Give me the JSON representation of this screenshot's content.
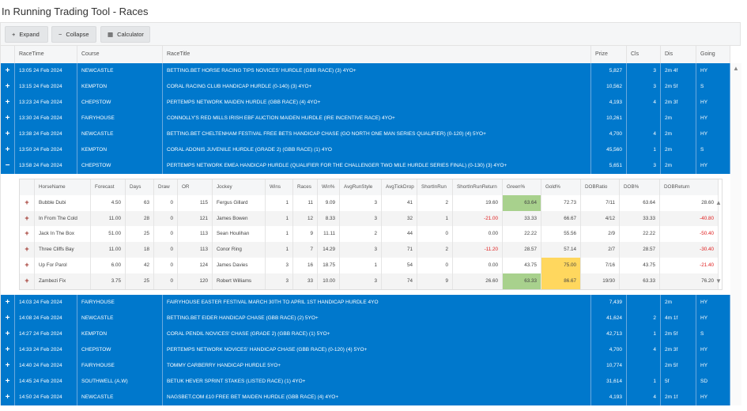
{
  "title": "In Running Trading Tool - Races",
  "toolbar": {
    "expand": "Expand",
    "collapse": "Collapse",
    "calculator": "Calculator"
  },
  "races_columns": [
    "RaceTime",
    "Course",
    "RaceTitle",
    "Prize",
    "Cls",
    "Dis",
    "Going"
  ],
  "races_top": [
    {
      "exp": "+",
      "time": "13:05 24 Feb 2024",
      "course": "NEWCASTLE",
      "title": "BETTING.BET HORSE RACING TIPS NOVICES' HURDLE (GBB RACE) (3) 4YO+",
      "prize": "5,827",
      "cls": "3",
      "dis": "2m 4f",
      "going": "HY"
    },
    {
      "exp": "+",
      "time": "13:15 24 Feb 2024",
      "course": "KEMPTON",
      "title": "CORAL RACING CLUB HANDICAP HURDLE (0-140) (3) 4YO+",
      "prize": "10,562",
      "cls": "3",
      "dis": "2m 5f",
      "going": "S"
    },
    {
      "exp": "+",
      "time": "13:23 24 Feb 2024",
      "course": "CHEPSTOW",
      "title": "PERTEMPS NETWORK MAIDEN HURDLE (GBB RACE) (4) 4YO+",
      "prize": "4,193",
      "cls": "4",
      "dis": "2m 3f",
      "going": "HY"
    },
    {
      "exp": "+",
      "time": "13:30 24 Feb 2024",
      "course": "FAIRYHOUSE",
      "title": "CONNOLLY'S RED MILLS IRISH EBF AUCTION MAIDEN HURDLE (IRE INCENTIVE RACE) 4YO+",
      "prize": "10,261",
      "cls": "",
      "dis": "2m",
      "going": "HY"
    },
    {
      "exp": "+",
      "time": "13:38 24 Feb 2024",
      "course": "NEWCASTLE",
      "title": "BETTING.BET CHELTENHAM FESTIVAL FREE BETS HANDICAP CHASE (GO NORTH ONE MAN SERIES QUALIFIER) (0-120) (4) 5YO+",
      "prize": "4,700",
      "cls": "4",
      "dis": "2m",
      "going": "HY"
    },
    {
      "exp": "+",
      "time": "13:50 24 Feb 2024",
      "course": "KEMPTON",
      "title": "CORAL ADONIS JUVENILE HURDLE (GRADE 2) (GBB RACE) (1) 4YO",
      "prize": "45,560",
      "cls": "1",
      "dis": "2m",
      "going": "S"
    },
    {
      "exp": "−",
      "time": "13:58 24 Feb 2024",
      "course": "CHEPSTOW",
      "title": "PERTEMPS NETWORK EMEA HANDICAP HURDLE (QUALIFIER FOR THE CHALLENGER TWO MILE HURDLE SERIES FINAL) (0-130) (3) 4YO+",
      "prize": "5,651",
      "cls": "3",
      "dis": "2m",
      "going": "HY"
    }
  ],
  "horse_columns": [
    "HorseName",
    "Forecast",
    "Days",
    "Draw",
    "OR",
    "Jockey",
    "Wins",
    "Races",
    "Win%",
    "AvgRunStyle",
    "AvgTickDrop",
    "ShortInRun",
    "ShortInRunReturn",
    "Green%",
    "Gold%",
    "DOBRatio",
    "DOB%",
    "DOBReturn"
  ],
  "horses": [
    {
      "name": "Bubble Dubi",
      "forecast": "4.50",
      "days": "63",
      "draw": "0",
      "or": "115",
      "jockey": "Fergus Gillard",
      "wins": "1",
      "races": "11",
      "winpct": "9.09",
      "runstyle": "3",
      "tickdrop": "41",
      "shortinrun": "2",
      "sirreturn": "19.60",
      "green": "63.64",
      "gold": "72.73",
      "dobratio": "7/11",
      "dobpct": "63.64",
      "dobreturn": "28.60"
    },
    {
      "name": "In From The Cold",
      "forecast": "11.00",
      "days": "28",
      "draw": "0",
      "or": "121",
      "jockey": "James Bowen",
      "wins": "1",
      "races": "12",
      "winpct": "8.33",
      "runstyle": "3",
      "tickdrop": "32",
      "shortinrun": "1",
      "sirreturn": "-21.00",
      "green": "33.33",
      "gold": "66.67",
      "dobratio": "4/12",
      "dobpct": "33.33",
      "dobreturn": "-40.80"
    },
    {
      "name": "Jack In The Box",
      "forecast": "51.00",
      "days": "25",
      "draw": "0",
      "or": "113",
      "jockey": "Sean Houlihan",
      "wins": "1",
      "races": "9",
      "winpct": "11.11",
      "runstyle": "2",
      "tickdrop": "44",
      "shortinrun": "0",
      "sirreturn": "0.00",
      "green": "22.22",
      "gold": "55.56",
      "dobratio": "2/9",
      "dobpct": "22.22",
      "dobreturn": "-50.40"
    },
    {
      "name": "Three Cliffs Bay",
      "forecast": "11.00",
      "days": "18",
      "draw": "0",
      "or": "113",
      "jockey": "Conor Ring",
      "wins": "1",
      "races": "7",
      "winpct": "14.29",
      "runstyle": "3",
      "tickdrop": "71",
      "shortinrun": "2",
      "sirreturn": "-11.20",
      "green": "28.57",
      "gold": "57.14",
      "dobratio": "2/7",
      "dobpct": "28.57",
      "dobreturn": "-30.40"
    },
    {
      "name": "Up For Parol",
      "forecast": "6.00",
      "days": "42",
      "draw": "0",
      "or": "124",
      "jockey": "James Davies",
      "wins": "3",
      "races": "16",
      "winpct": "18.75",
      "runstyle": "1",
      "tickdrop": "54",
      "shortinrun": "0",
      "sirreturn": "0.00",
      "green": "43.75",
      "gold": "75.00",
      "dobratio": "7/16",
      "dobpct": "43.75",
      "dobreturn": "-21.40"
    },
    {
      "name": "Zambezi Fix",
      "forecast": "3.75",
      "days": "25",
      "draw": "0",
      "or": "120",
      "jockey": "Robert Williams",
      "wins": "3",
      "races": "33",
      "winpct": "10.00",
      "runstyle": "3",
      "tickdrop": "74",
      "shortinrun": "9",
      "sirreturn": "26.60",
      "green": "63.33",
      "gold": "86.67",
      "dobratio": "19/30",
      "dobpct": "63.33",
      "dobreturn": "76.20"
    }
  ],
  "highlights": {
    "green_cells": [
      0,
      5
    ],
    "gold_cells": [
      4,
      5
    ],
    "green_color": "#a8d18d",
    "gold_color": "#ffd75e",
    "row_color": "#0078cc",
    "negative_color": "#e02020"
  },
  "races_bottom": [
    {
      "exp": "+",
      "time": "14:03 24 Feb 2024",
      "course": "FAIRYHOUSE",
      "title": "FAIRYHOUSE EASTER FESTIVAL MARCH 30TH TO APRIL 1ST HANDICAP HURDLE 4YO",
      "prize": "7,439",
      "cls": "",
      "dis": "2m",
      "going": "HY"
    },
    {
      "exp": "+",
      "time": "14:08 24 Feb 2024",
      "course": "NEWCASTLE",
      "title": "BETTING.BET EIDER HANDICAP CHASE (GBB RACE) (2) 5YO+",
      "prize": "41,624",
      "cls": "2",
      "dis": "4m 1f",
      "going": "HY"
    },
    {
      "exp": "+",
      "time": "14:27 24 Feb 2024",
      "course": "KEMPTON",
      "title": "CORAL PENDIL NOVICES' CHASE (GRADE 2) (GBB RACE) (1) 5YO+",
      "prize": "42,713",
      "cls": "1",
      "dis": "2m 5f",
      "going": "S"
    },
    {
      "exp": "+",
      "time": "14:33 24 Feb 2024",
      "course": "CHEPSTOW",
      "title": "PERTEMPS NETWORK NOVICES' HANDICAP CHASE (GBB RACE) (0-120) (4) 5YO+",
      "prize": "4,700",
      "cls": "4",
      "dis": "2m 3f",
      "going": "HY"
    },
    {
      "exp": "+",
      "time": "14:40 24 Feb 2024",
      "course": "FAIRYHOUSE",
      "title": "TOMMY CARBERRY HANDICAP HURDLE 5YO+",
      "prize": "10,774",
      "cls": "",
      "dis": "2m 5f",
      "going": "HY"
    },
    {
      "exp": "+",
      "time": "14:45 24 Feb 2024",
      "course": "SOUTHWELL (A.W)",
      "title": "BETUK HEVER SPRINT STAKES (LISTED RACE) (1) 4YO+",
      "prize": "31,614",
      "cls": "1",
      "dis": "5f",
      "going": "SD"
    },
    {
      "exp": "+",
      "time": "14:50 24 Feb 2024",
      "course": "NEWCASTLE",
      "title": "NAGSBET.COM £10 FREE BET MAIDEN HURDLE (GBB RACE) (4) 4YO+",
      "prize": "4,193",
      "cls": "4",
      "dis": "2m 1f",
      "going": "HY"
    }
  ]
}
